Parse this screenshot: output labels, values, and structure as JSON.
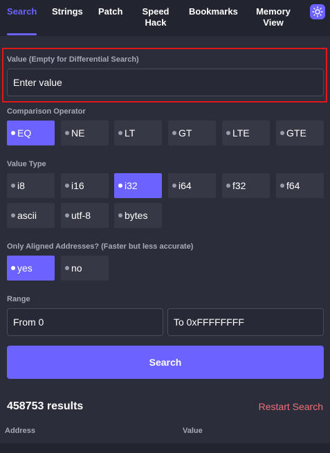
{
  "nav": {
    "tabs": [
      {
        "label": "Search",
        "active": true
      },
      {
        "label": "Strings"
      },
      {
        "label": "Patch"
      },
      {
        "label": "Speed Hack"
      },
      {
        "label": "Bookmarks"
      },
      {
        "label": "Memory View"
      }
    ],
    "theme_toggle_icon": "sun-icon"
  },
  "value": {
    "label": "Value (Empty for Differential Search)",
    "placeholder": "Enter value"
  },
  "comparison": {
    "label": "Comparison Operator",
    "options": [
      "EQ",
      "NE",
      "LT",
      "GT",
      "LTE",
      "GTE"
    ],
    "selected": "EQ"
  },
  "value_type": {
    "label": "Value Type",
    "options": [
      "i8",
      "i16",
      "i32",
      "i64",
      "f32",
      "f64",
      "ascii",
      "utf-8",
      "bytes"
    ],
    "selected": "i32"
  },
  "aligned": {
    "label": "Only Aligned Addresses? (Faster but less accurate)",
    "options": [
      "yes",
      "no"
    ],
    "selected": "yes"
  },
  "range": {
    "label": "Range",
    "from_value": "From 0",
    "to_value": "To 0xFFFFFFFF"
  },
  "search_button": "Search",
  "results": {
    "count_text": "458753 results",
    "restart_label": "Restart Search",
    "columns": [
      "Address",
      "Value"
    ]
  },
  "colors": {
    "accent": "#6c63ff",
    "background": "#2b2d3a",
    "nav_background": "#222430",
    "option_background": "#363846",
    "highlight_border": "#e01818",
    "restart_link": "#f0707a"
  }
}
